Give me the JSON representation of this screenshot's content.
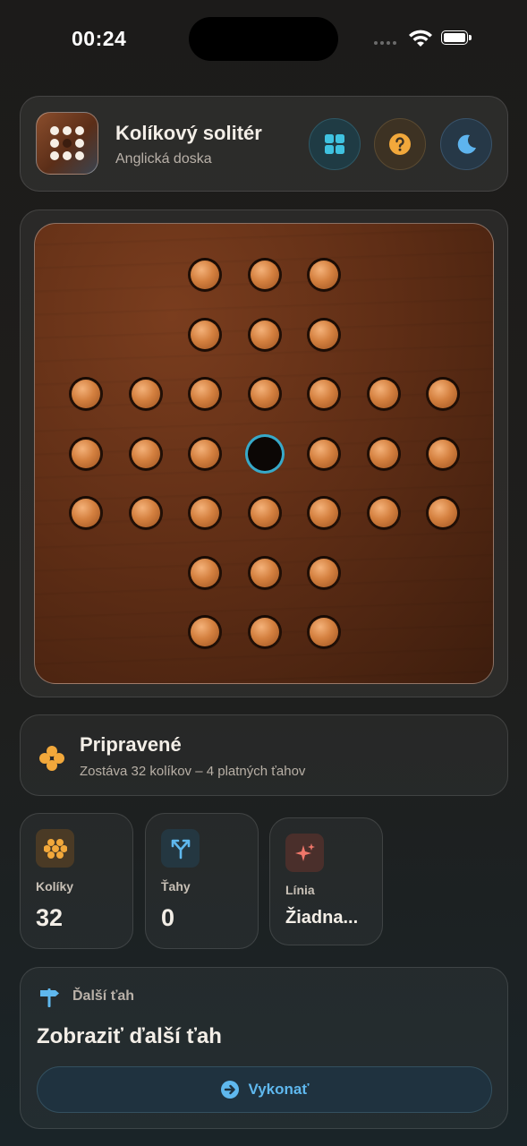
{
  "status_bar": {
    "time": "00:24"
  },
  "header": {
    "title": "Kolíkový solitér",
    "subtitle": "Anglická doska",
    "buttons": [
      {
        "icon": "grid-icon",
        "color": "#3fc2e0"
      },
      {
        "icon": "question-icon",
        "color": "#f2a83b"
      },
      {
        "icon": "moon-icon",
        "color": "#5eb4ee"
      }
    ]
  },
  "board": {
    "layout": "english-cross",
    "empty_hole": "center",
    "rows": [
      [
        0,
        0,
        1,
        1,
        1,
        0,
        0
      ],
      [
        0,
        0,
        1,
        1,
        1,
        0,
        0
      ],
      [
        1,
        1,
        1,
        1,
        1,
        1,
        1
      ],
      [
        1,
        1,
        1,
        2,
        1,
        1,
        1
      ],
      [
        1,
        1,
        1,
        1,
        1,
        1,
        1
      ],
      [
        0,
        0,
        1,
        1,
        1,
        0,
        0
      ],
      [
        0,
        0,
        1,
        1,
        1,
        0,
        0
      ]
    ],
    "legend": {
      "0": "none",
      "1": "peg",
      "2": "empty"
    }
  },
  "status": {
    "title": "Pripravené",
    "description": "Zostáva 32 kolíkov – 4 platných ťahov"
  },
  "stats": {
    "pegs": {
      "label": "Kolíky",
      "value": "32"
    },
    "moves": {
      "label": "Ťahy",
      "value": "0"
    },
    "line": {
      "label": "Línia",
      "value": "Žiadna..."
    }
  },
  "next_move": {
    "header": "Ďalší ťah",
    "title": "Zobraziť ďalší ťah",
    "button_label": "Vykonať"
  },
  "colors": {
    "accent_orange": "#f2a83b",
    "accent_blue": "#5fb8ee",
    "accent_cyan": "#37a9c9",
    "peg": "#d4803f"
  }
}
